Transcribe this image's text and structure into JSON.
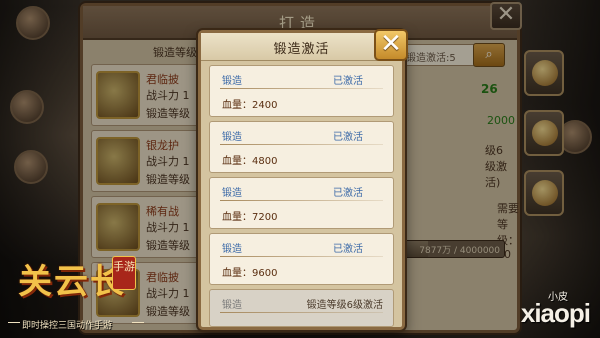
{
  "background_panel": {
    "title": "打造",
    "close_label": "✕",
    "top_label": "锻造等级",
    "search_placeholder": "锻造激活:5",
    "items": [
      {
        "name": "君临披",
        "power": "战斗力 1",
        "req": "锻造等级"
      },
      {
        "name": "银龙护",
        "power": "战斗力 1",
        "req": "锻造等级"
      },
      {
        "name": "稀有战",
        "power": "战斗力 1",
        "req": "锻造等级"
      },
      {
        "name": "君临披",
        "power": "战斗力 1",
        "req": "锻造等级"
      }
    ],
    "stats": {
      "value_a": "26",
      "value_b": "2000",
      "level_note": "级6级激活)",
      "need_level": "需要等级：50"
    },
    "progress": {
      "text": "7877万 / 4000000",
      "fraction": 0.25
    }
  },
  "modal": {
    "title": "锻造激活",
    "close_label": "✕",
    "cards": [
      {
        "name": "锻造",
        "status": "已激活",
        "stat": "血量：2400",
        "locked": false
      },
      {
        "name": "锻造",
        "status": "已激活",
        "stat": "血量：4800",
        "locked": false
      },
      {
        "name": "锻造",
        "status": "已激活",
        "stat": "血量：7200",
        "locked": false
      },
      {
        "name": "锻造",
        "status": "已激活",
        "stat": "血量：9600",
        "locked": false
      },
      {
        "name": "锻造",
        "status": "锻造等级6级激活",
        "stat": "",
        "locked": true
      }
    ]
  },
  "branding": {
    "logo": "关云长",
    "badge": "手游",
    "tagline": "即时操控三国动作手游",
    "watermark_small": "小皮",
    "watermark_big": "xiaopi"
  },
  "colors": {
    "active_blue": "#3c6aa8",
    "stat_brown": "#5a2e10",
    "modal_bg": "#d4c4a0",
    "close_gold": "#f2c868"
  }
}
